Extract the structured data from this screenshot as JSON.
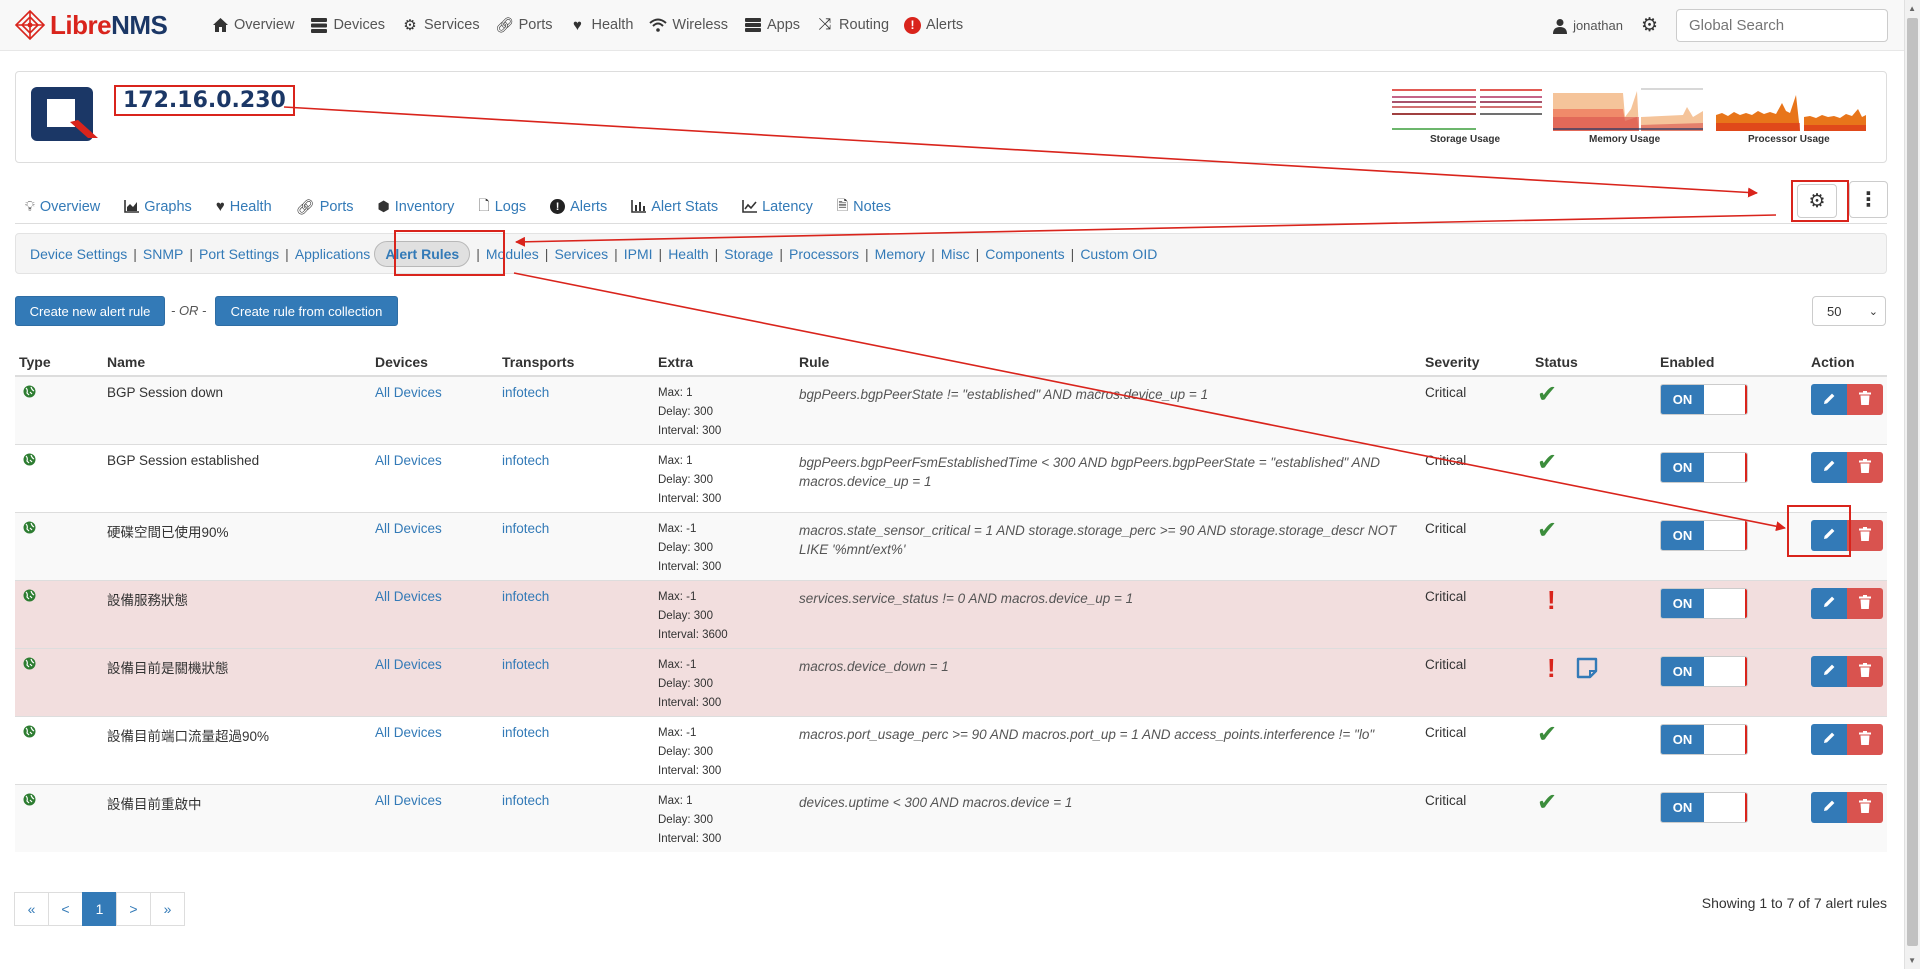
{
  "brand": {
    "libre": "Libre",
    "nms": "NMS"
  },
  "nav": {
    "items": [
      {
        "label": "Overview",
        "icon": "home-icon"
      },
      {
        "label": "Devices",
        "icon": "server-icon"
      },
      {
        "label": "Services",
        "icon": "cogs-icon"
      },
      {
        "label": "Ports",
        "icon": "link-icon"
      },
      {
        "label": "Health",
        "icon": "heartbeat-icon"
      },
      {
        "label": "Wireless",
        "icon": "wifi-icon"
      },
      {
        "label": "Apps",
        "icon": "tasks-icon"
      },
      {
        "label": "Routing",
        "icon": "random-icon"
      },
      {
        "label": "Alerts",
        "icon": "alert-icon"
      }
    ],
    "user": "jonathan",
    "search_placeholder": "Global Search"
  },
  "device": {
    "ip": "172.16.0.230",
    "graphs": [
      {
        "caption": "Storage Usage"
      },
      {
        "caption": "Memory Usage"
      },
      {
        "caption": "Processor Usage"
      }
    ]
  },
  "device_tabs": [
    {
      "label": "Overview",
      "icon": "lightbulb-icon"
    },
    {
      "label": "Graphs",
      "icon": "area-chart-icon"
    },
    {
      "label": "Health",
      "icon": "heartbeat-icon"
    },
    {
      "label": "Ports",
      "icon": "link-icon"
    },
    {
      "label": "Inventory",
      "icon": "cube-icon"
    },
    {
      "label": "Logs",
      "icon": "file-icon"
    },
    {
      "label": "Alerts",
      "icon": "exclamation-circle-icon"
    },
    {
      "label": "Alert Stats",
      "icon": "bar-chart-icon"
    },
    {
      "label": "Latency",
      "icon": "line-chart-icon"
    },
    {
      "label": "Notes",
      "icon": "file-text-icon"
    }
  ],
  "edit_nav": {
    "items": [
      "Device Settings",
      "SNMP",
      "Port Settings",
      "Applications"
    ],
    "active": "Alert Rules",
    "items_after": [
      "Modules",
      "Services",
      "IPMI",
      "Health",
      "Storage",
      "Processors",
      "Memory",
      "Misc",
      "Components",
      "Custom OID"
    ]
  },
  "actions": {
    "create_new": "Create new alert rule",
    "or": "- OR -",
    "create_from_collection": "Create rule from collection",
    "per_page": "50"
  },
  "table": {
    "headers": [
      "Type",
      "Name",
      "Devices",
      "Transports",
      "Extra",
      "Rule",
      "Severity",
      "Status",
      "Enabled",
      "Action"
    ],
    "rows": [
      {
        "name": "BGP Session down",
        "devices": "All Devices",
        "transports": "infotech",
        "max": "Max: 1",
        "delay": "Delay: 300",
        "interval": "Interval: 300",
        "rule": "bgpPeers.bgpPeerState != \"established\" AND macros.device_up = 1",
        "severity": "Critical",
        "status": "ok",
        "enabled": "ON"
      },
      {
        "name": "BGP Session established",
        "devices": "All Devices",
        "transports": "infotech",
        "max": "Max: 1",
        "delay": "Delay: 300",
        "interval": "Interval: 300",
        "rule": "bgpPeers.bgpPeerFsmEstablishedTime < 300 AND bgpPeers.bgpPeerState = \"established\" AND macros.device_up = 1",
        "severity": "Critical",
        "status": "ok",
        "enabled": "ON"
      },
      {
        "name": "硬碟空間已使用90%",
        "devices": "All Devices",
        "transports": "infotech",
        "max": "Max: -1",
        "delay": "Delay: 300",
        "interval": "Interval: 300",
        "rule": "macros.state_sensor_critical = 1 AND storage.storage_perc >= 90 AND storage.storage_descr NOT LIKE '%mnt/ext%'",
        "severity": "Critical",
        "status": "ok",
        "enabled": "ON"
      },
      {
        "name": "設備服務狀態",
        "devices": "All Devices",
        "transports": "infotech",
        "max": "Max: -1",
        "delay": "Delay: 300",
        "interval": "Interval: 3600",
        "rule": "services.service_status != 0 AND macros.device_up = 1",
        "severity": "Critical",
        "status": "alert",
        "enabled": "ON"
      },
      {
        "name": "設備目前是關機狀態",
        "devices": "All Devices",
        "transports": "infotech",
        "max": "Max: -1",
        "delay": "Delay: 300",
        "interval": "Interval: 300",
        "rule": "macros.device_down = 1",
        "severity": "Critical",
        "status": "alert-note",
        "enabled": "ON"
      },
      {
        "name": "設備目前端口流量超過90%",
        "devices": "All Devices",
        "transports": "infotech",
        "max": "Max: -1",
        "delay": "Delay: 300",
        "interval": "Interval: 300",
        "rule": "macros.port_usage_perc >= 90 AND macros.port_up = 1 AND access_points.interference != \"lo\"",
        "severity": "Critical",
        "status": "ok",
        "enabled": "ON"
      },
      {
        "name": "設備目前重啟中",
        "devices": "All Devices",
        "transports": "infotech",
        "max": "Max: 1",
        "delay": "Delay: 300",
        "interval": "Interval: 300",
        "rule": "devices.uptime < 300 AND macros.device = 1",
        "severity": "Critical",
        "status": "ok",
        "enabled": "ON"
      }
    ]
  },
  "pagination": {
    "first": "«",
    "prev": "<",
    "current": "1",
    "next": ">",
    "last": "»",
    "showing": "Showing 1 to 7 of 7 alert rules"
  },
  "colors": {
    "accent": "#337ab7",
    "danger": "#d9534f",
    "annotation": "#d9241c",
    "success": "#3c8d3c"
  }
}
